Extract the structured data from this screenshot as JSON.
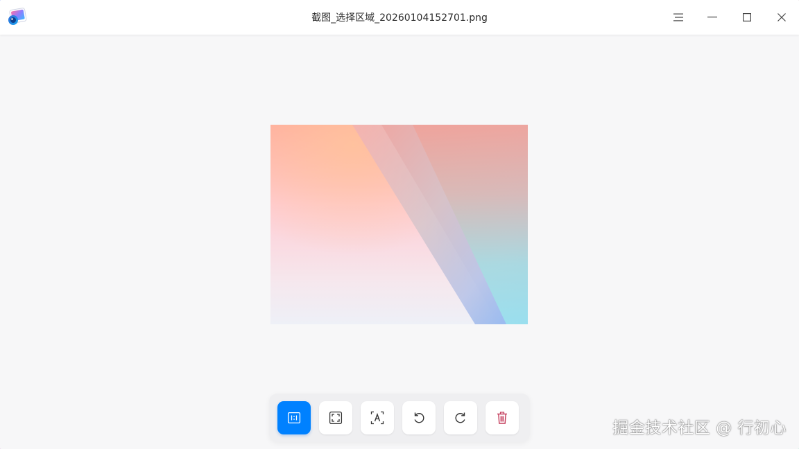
{
  "window": {
    "title": "截图_选择区域_20260104152701.png",
    "icons": {
      "app": "image-viewer-app-icon",
      "menu": "hamburger-menu-icon",
      "minimize": "minimize-icon",
      "maximize": "maximize-icon",
      "close": "close-icon"
    }
  },
  "toolbar": {
    "buttons": [
      {
        "name": "original-size",
        "icon": "one-to-one-icon",
        "active": true
      },
      {
        "name": "fit-to-window",
        "icon": "fit-window-icon",
        "active": false
      },
      {
        "name": "extract-text",
        "icon": "ocr-text-icon",
        "active": false
      },
      {
        "name": "rotate-left",
        "icon": "rotate-counterclockwise-icon",
        "active": false
      },
      {
        "name": "rotate-right",
        "icon": "rotate-clockwise-icon",
        "active": false
      },
      {
        "name": "delete",
        "icon": "trash-icon",
        "active": false
      }
    ],
    "colors": {
      "active": "#0081ff",
      "delete": "#c33b5a"
    }
  },
  "watermark": {
    "text": "掘金技术社区 @ 行初心"
  }
}
